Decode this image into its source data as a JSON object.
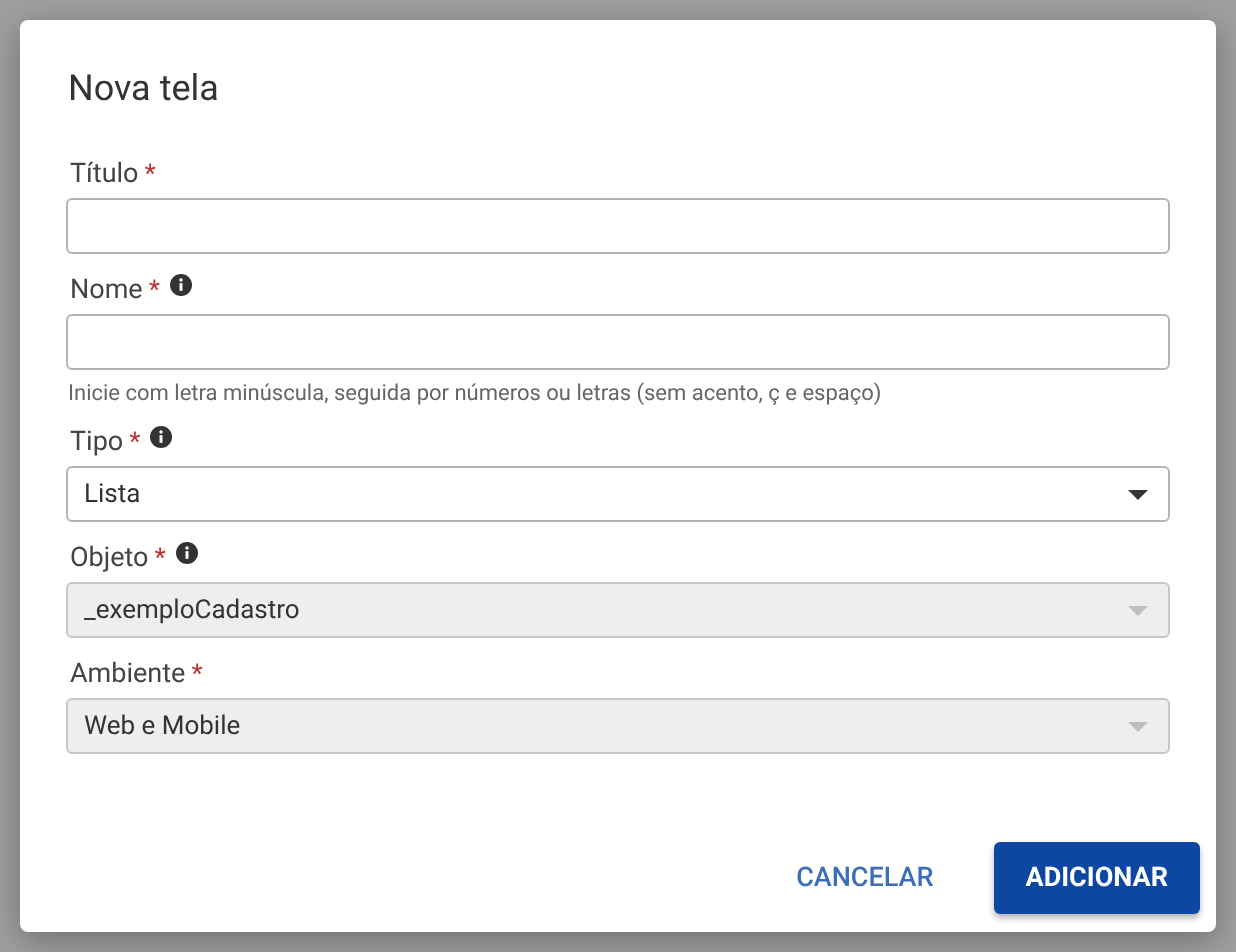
{
  "dialog": {
    "title": "Nova tela",
    "fields": [
      {
        "label": "Título",
        "required": "*",
        "info": false,
        "kind": "text",
        "disabled": false
      },
      {
        "label": "Nome",
        "required": "*",
        "info": true,
        "kind": "text",
        "disabled": false,
        "hint": "Inicie com letra minúscula, seguida por números ou letras (sem acento, ç e espaço)"
      },
      {
        "label": "Tipo",
        "required": "*",
        "info": true,
        "kind": "select",
        "disabled": false,
        "value": "Lista"
      },
      {
        "label": "Objeto",
        "required": "*",
        "info": true,
        "kind": "select",
        "disabled": true,
        "value": "_exemploCadastro"
      },
      {
        "label": "Ambiente",
        "required": "*",
        "info": false,
        "kind": "select",
        "disabled": true,
        "value": "Web e Mobile"
      }
    ],
    "buttons": [
      {
        "label": "CANCELAR",
        "kind": "text"
      },
      {
        "label": "ADICIONAR",
        "kind": "primary"
      }
    ]
  }
}
